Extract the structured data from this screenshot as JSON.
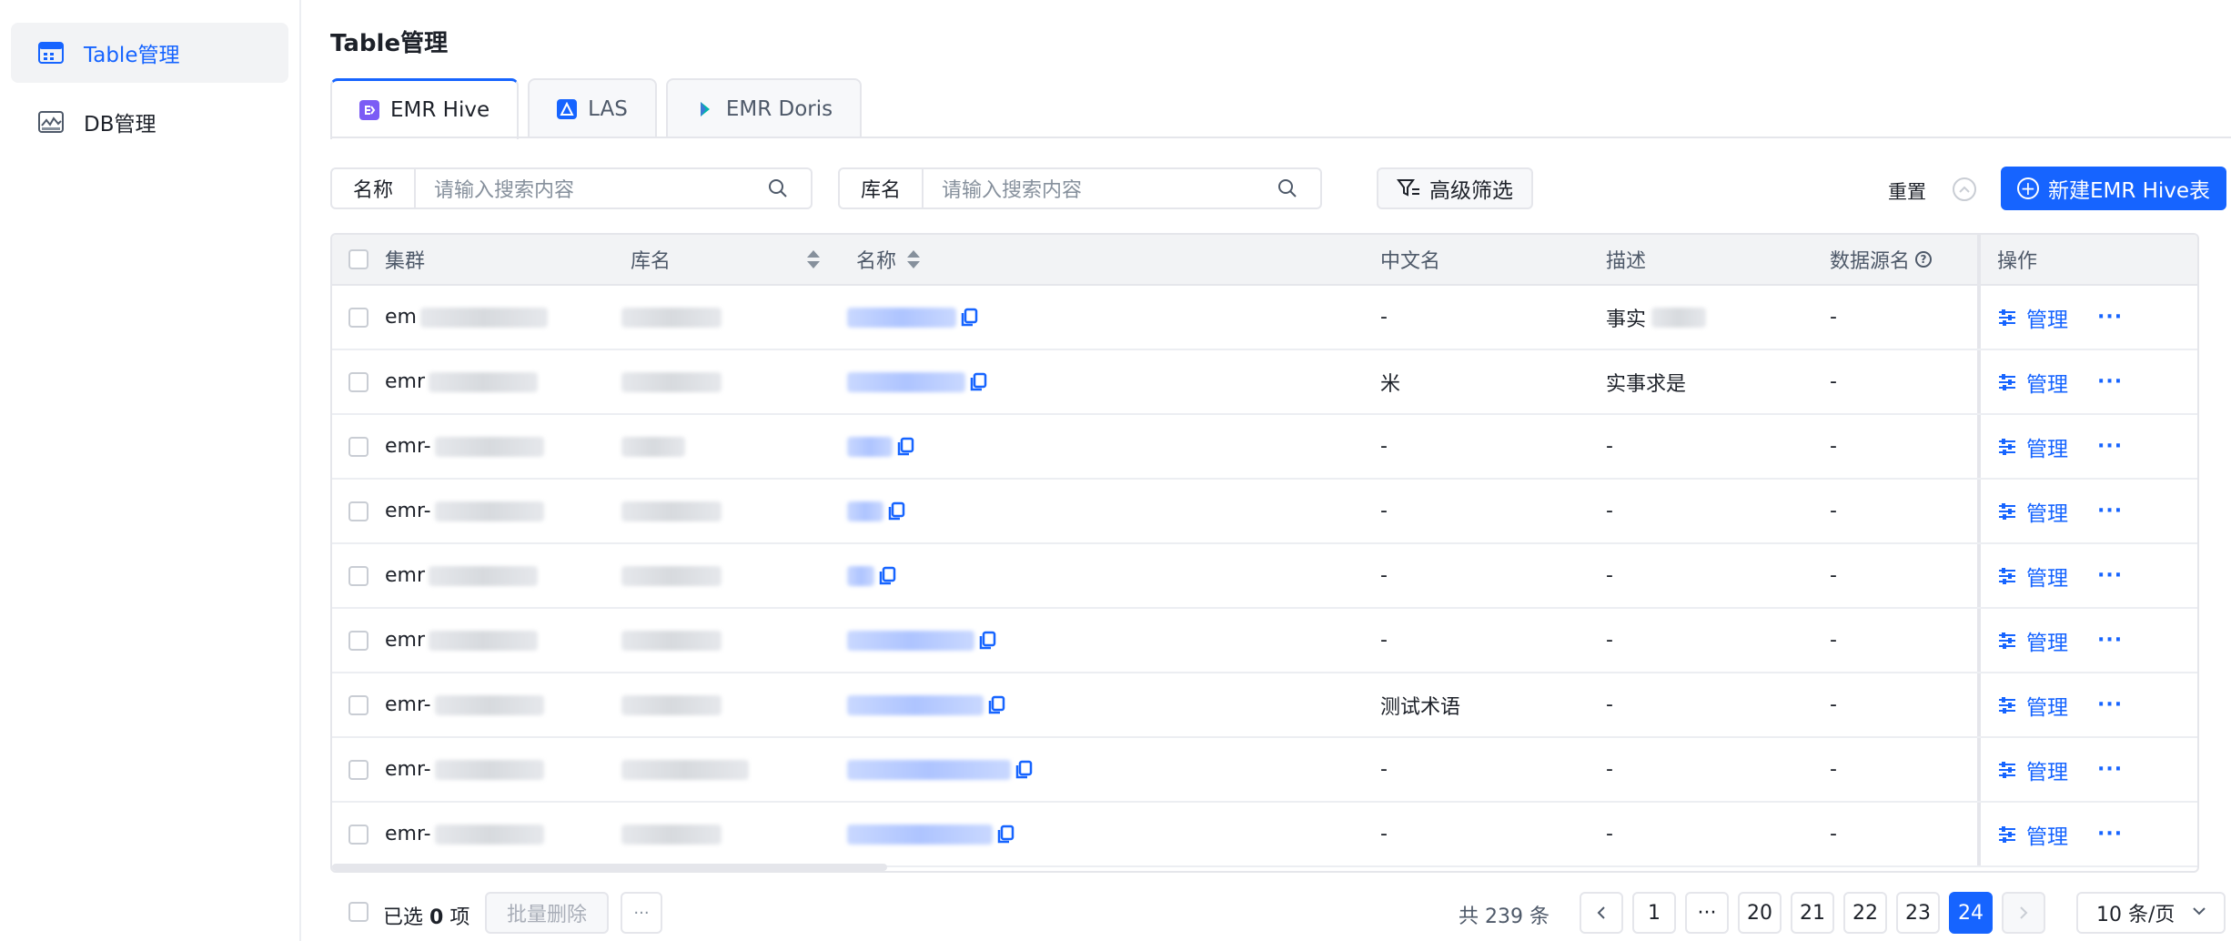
{
  "sidebar": {
    "items": [
      {
        "label": "Table管理",
        "icon": "table-icon",
        "active": true
      },
      {
        "label": "DB管理",
        "icon": "database-icon",
        "active": false
      }
    ]
  },
  "page": {
    "title": "Table管理"
  },
  "tabs": [
    {
      "label": "EMR Hive",
      "icon": "emr-hive-icon",
      "active": true
    },
    {
      "label": "LAS",
      "icon": "las-icon",
      "active": false
    },
    {
      "label": "EMR Doris",
      "icon": "emr-doris-icon",
      "active": false
    }
  ],
  "filters": {
    "name_label": "名称",
    "name_placeholder": "请输入搜索内容",
    "db_label": "库名",
    "db_placeholder": "请输入搜索内容",
    "advanced_label": "高级筛选",
    "reset_label": "重置",
    "new_button_label": "新建EMR Hive表"
  },
  "table": {
    "columns": [
      "集群",
      "库名",
      "名称",
      "中文名",
      "描述",
      "数据源名",
      "操作"
    ],
    "rows": [
      {
        "cluster": "em",
        "cn": "-",
        "desc": "事实",
        "source": "-"
      },
      {
        "cluster": "emr",
        "cn": "米",
        "desc": "实事求是",
        "source": "-"
      },
      {
        "cluster": "emr-",
        "cn": "-",
        "desc": "-",
        "source": "-"
      },
      {
        "cluster": "emr-",
        "cn": "-",
        "desc": "-",
        "source": "-"
      },
      {
        "cluster": "emr",
        "cn": "-",
        "desc": "-",
        "source": "-"
      },
      {
        "cluster": "emr",
        "cn": "-",
        "desc": "-",
        "source": "-"
      },
      {
        "cluster": "emr-",
        "cn": "测试术语",
        "desc": "-",
        "source": "-"
      },
      {
        "cluster": "emr-",
        "cn": "-",
        "desc": "-",
        "source": "-"
      },
      {
        "cluster": "emr-",
        "cn": "-",
        "desc": "-",
        "source": "-"
      }
    ],
    "manage_label": "管理",
    "more_label": "···"
  },
  "footer": {
    "selected_prefix": "已选",
    "selected_count": "0",
    "selected_suffix": "项",
    "batch_delete_label": "批量删除",
    "total_text": "共 239 条",
    "pages": [
      "1",
      "···",
      "20",
      "21",
      "22",
      "23",
      "24"
    ],
    "active_page": "24",
    "page_size": "10 条/页"
  },
  "colors": {
    "accent": "#1664ff",
    "header_bg": "#f2f3f5",
    "border": "#e5e6eb"
  }
}
